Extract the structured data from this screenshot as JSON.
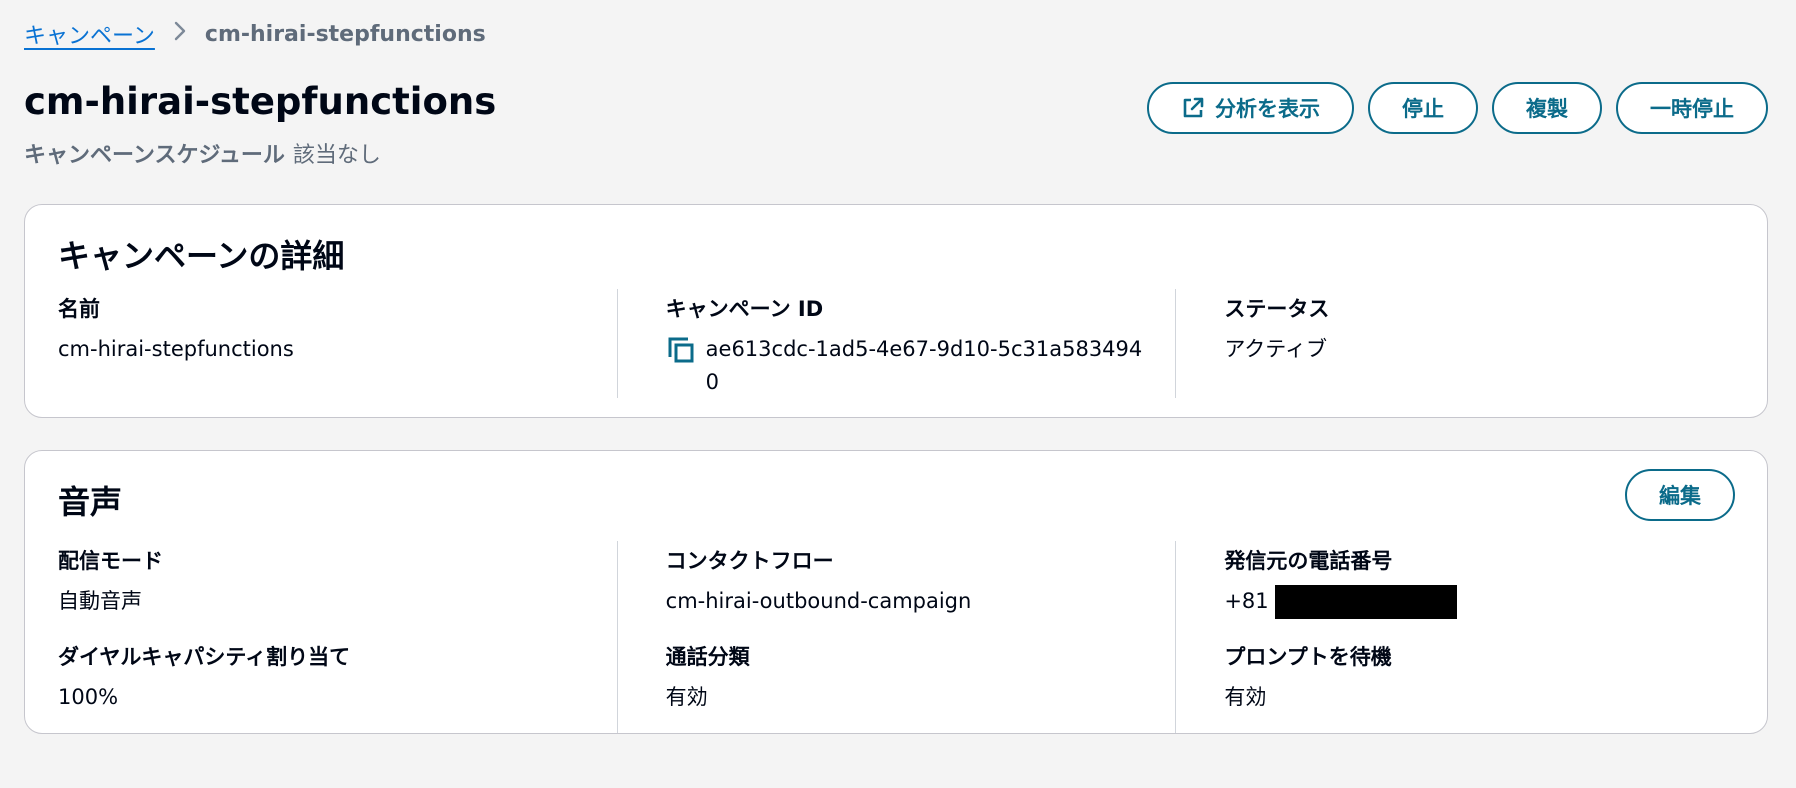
{
  "breadcrumb": {
    "parent": "キャンペーン",
    "current": "cm-hirai-stepfunctions"
  },
  "header": {
    "title": "cm-hirai-stepfunctions",
    "schedule_label": "キャンペーンスケジュール",
    "schedule_value": "該当なし",
    "actions": {
      "analytics": "分析を表示",
      "stop": "停止",
      "duplicate": "複製",
      "pause": "一時停止"
    }
  },
  "details": {
    "title": "キャンペーンの詳細",
    "name_label": "名前",
    "name_value": "cm-hirai-stepfunctions",
    "id_label": "キャンペーン ID",
    "id_value": "ae613cdc-1ad5-4e67-9d10-5c31a5834940",
    "status_label": "ステータス",
    "status_value": "アクティブ"
  },
  "voice": {
    "title": "音声",
    "edit": "編集",
    "mode_label": "配信モード",
    "mode_value": "自動音声",
    "flow_label": "コンタクトフロー",
    "flow_value": "cm-hirai-outbound-campaign",
    "phone_label": "発信元の電話番号",
    "phone_prefix": "+81",
    "capacity_label": "ダイヤルキャパシティ割り当て",
    "capacity_value": "100%",
    "classification_label": "通話分類",
    "classification_value": "有効",
    "prompt_label": "プロンプトを待機",
    "prompt_value": "有効"
  }
}
